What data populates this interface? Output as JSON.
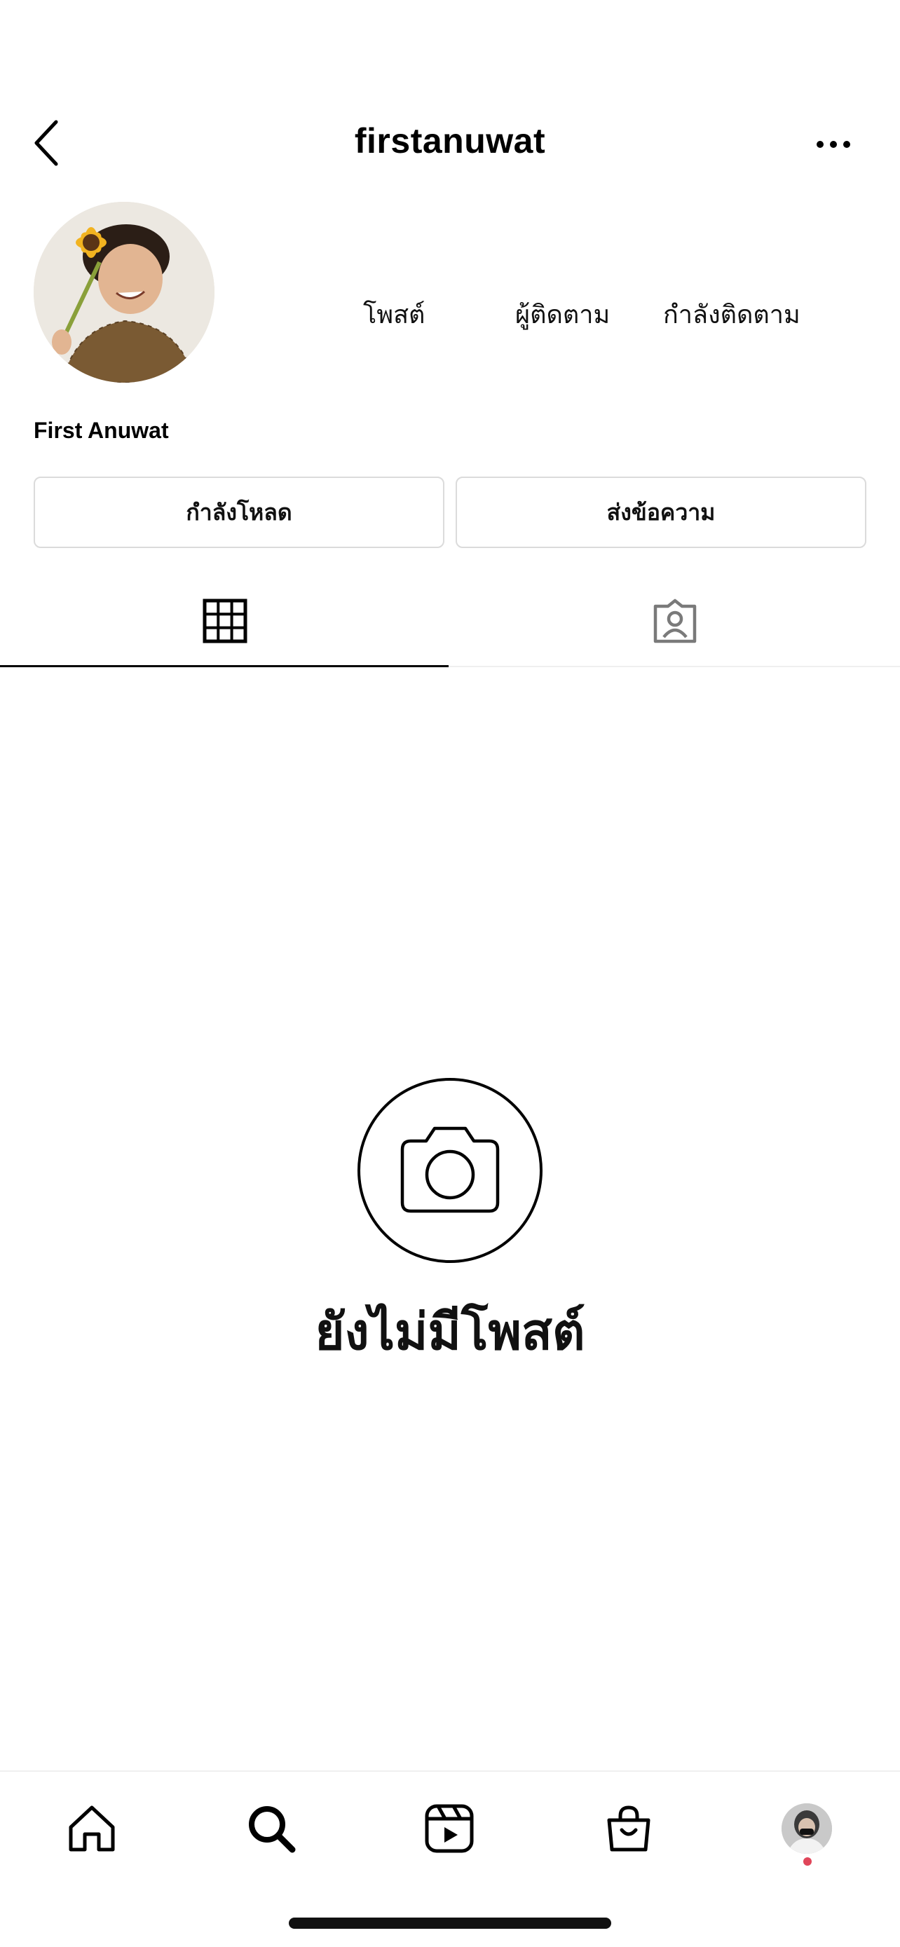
{
  "header": {
    "username": "firstanuwat",
    "back_icon": "chevron-left-icon",
    "more_icon": "more-horizontal-icon"
  },
  "profile": {
    "display_name": "First Anuwat",
    "stats": {
      "posts_label": "โพสต์",
      "followers_label": "ผู้ติดตาม",
      "following_label": "กำลังติดตาม"
    },
    "buttons": {
      "follow_label": "กำลังโหลด",
      "message_label": "ส่งข้อความ"
    }
  },
  "tabs": [
    {
      "name": "grid",
      "icon": "grid-icon",
      "active": true
    },
    {
      "name": "tagged",
      "icon": "tagged-user-icon",
      "active": false
    }
  ],
  "empty_state": {
    "icon": "camera-icon",
    "text": "ยังไม่มีโพสต์"
  },
  "bottom_nav": [
    {
      "name": "home",
      "icon": "home-icon"
    },
    {
      "name": "search",
      "icon": "search-icon"
    },
    {
      "name": "reels",
      "icon": "reels-icon"
    },
    {
      "name": "shop",
      "icon": "shopping-bag-icon"
    },
    {
      "name": "profile",
      "icon": "avatar"
    }
  ],
  "colors": {
    "notification_dot": "#e0465a",
    "border": "#dbdbdb"
  }
}
